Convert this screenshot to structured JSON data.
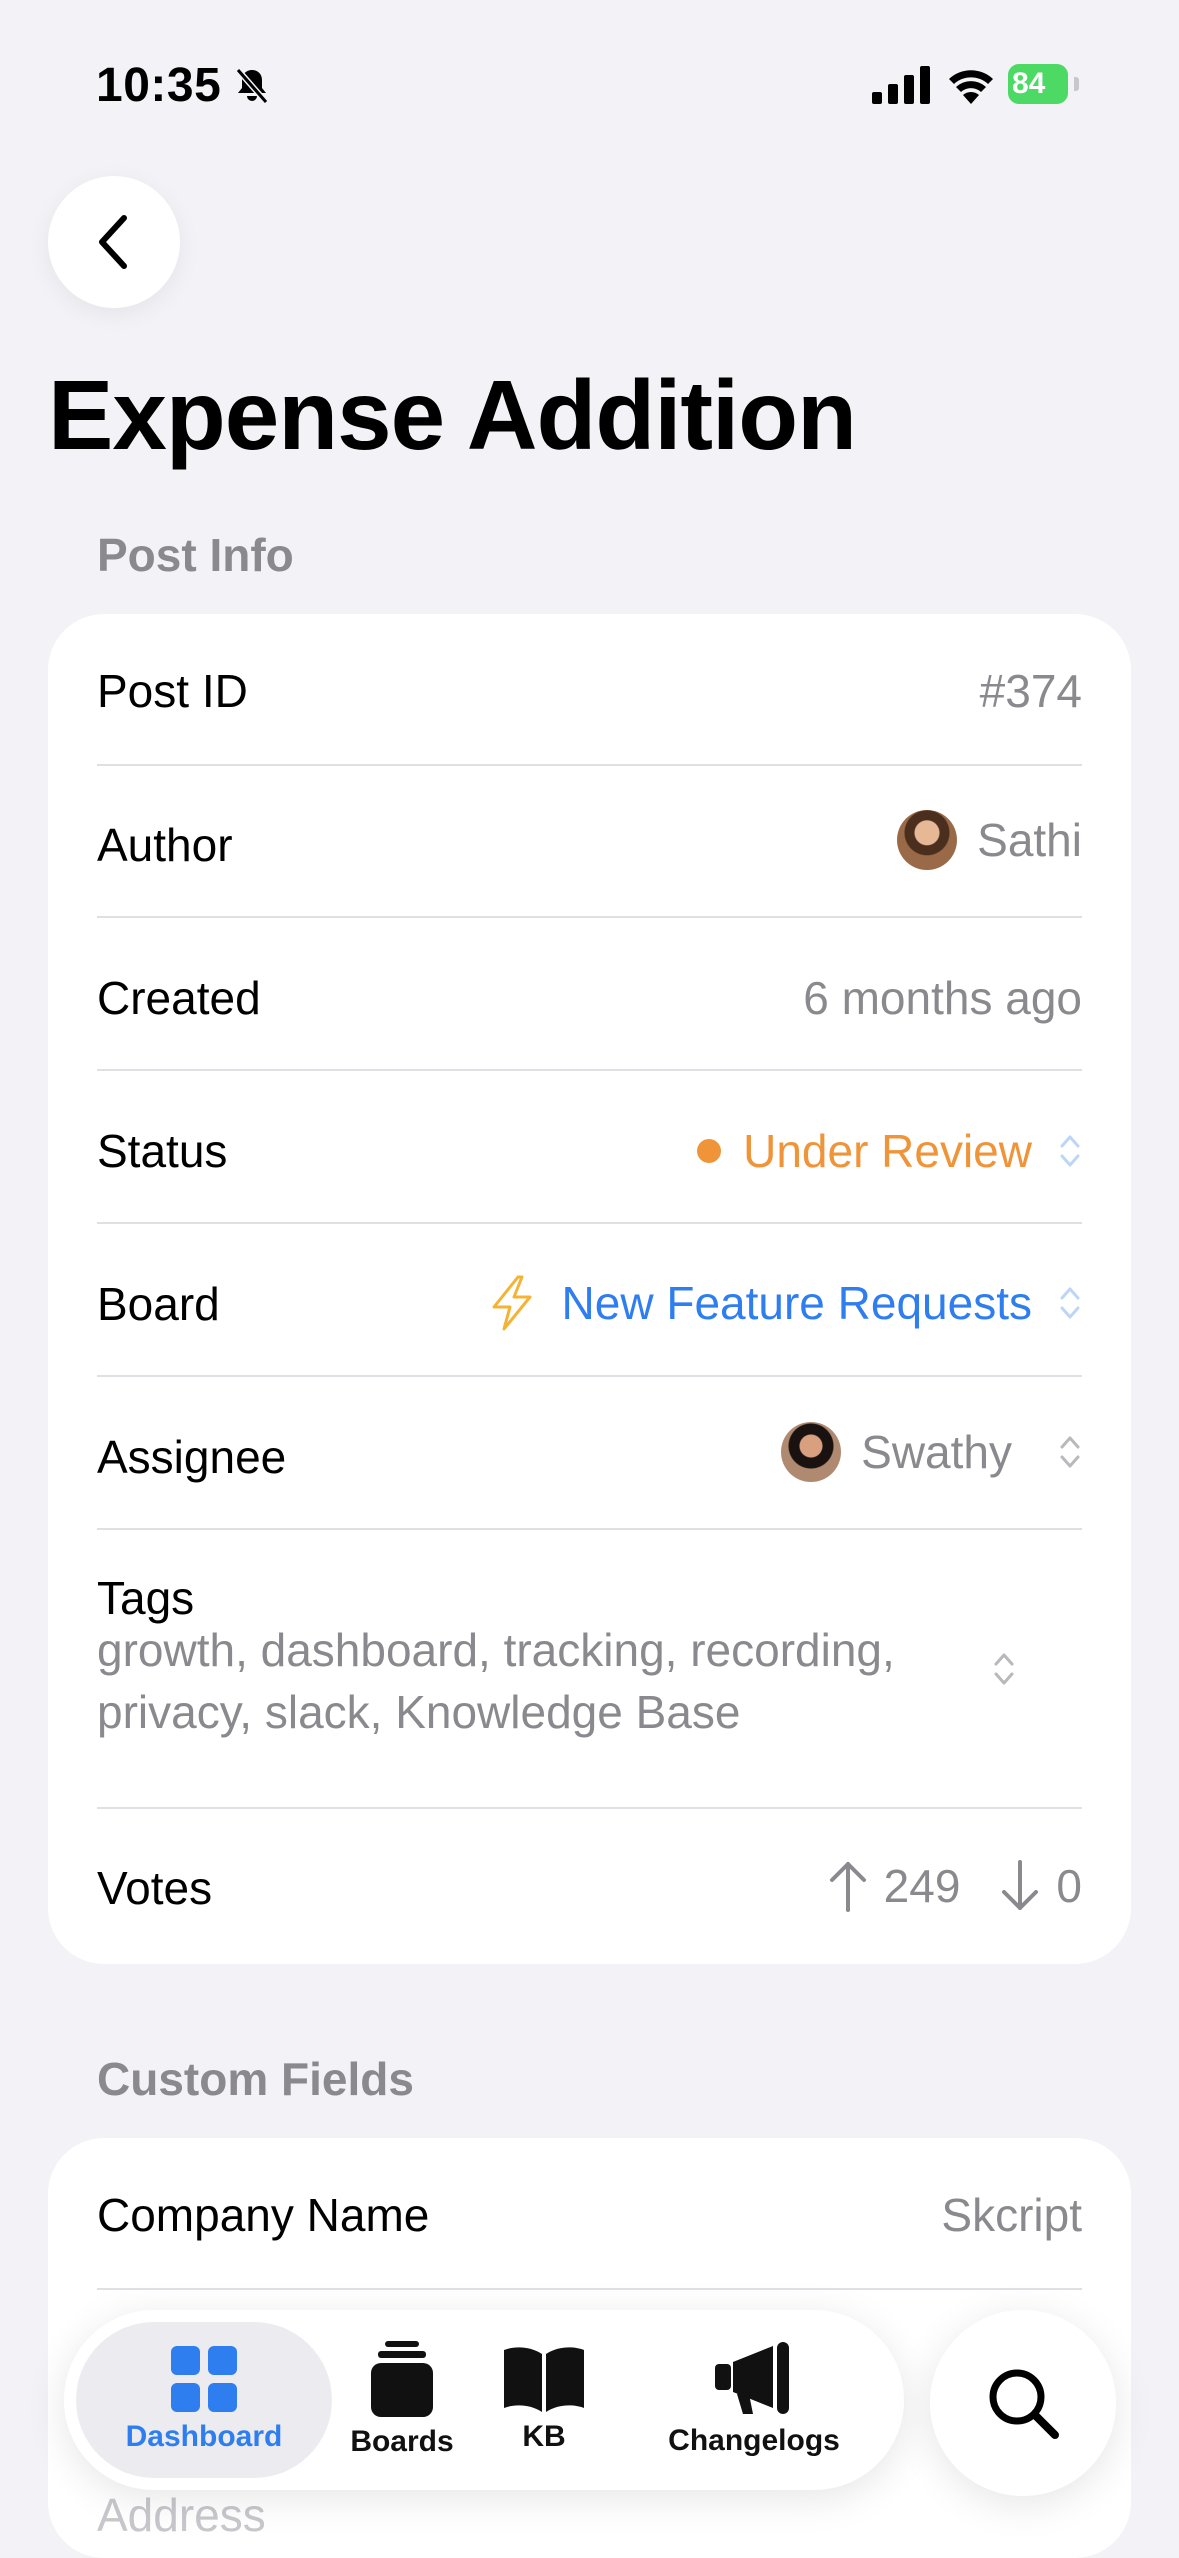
{
  "status_bar": {
    "time": "10:35",
    "battery": "84"
  },
  "page": {
    "title": "Expense Addition"
  },
  "post_info": {
    "section_label": "Post Info",
    "post_id": {
      "label": "Post ID",
      "value": "#374"
    },
    "author": {
      "label": "Author",
      "value": "Sathi"
    },
    "created": {
      "label": "Created",
      "value": "6 months ago"
    },
    "status": {
      "label": "Status",
      "value": "Under Review",
      "color": "#f0943a"
    },
    "board": {
      "label": "Board",
      "value": "New Feature Requests",
      "color": "#2f7ef0",
      "icon": "lightning-icon"
    },
    "assignee": {
      "label": "Assignee",
      "value": "Swathy"
    },
    "tags": {
      "label": "Tags",
      "value": "growth, dashboard, tracking, recording, privacy, slack, Knowledge Base"
    },
    "votes": {
      "label": "Votes",
      "up": "249",
      "down": "0"
    }
  },
  "custom_fields": {
    "section_label": "Custom Fields",
    "company_name": {
      "label": "Company Name",
      "value": "Skcript"
    },
    "address": {
      "label": "Address"
    }
  },
  "tab_bar": {
    "active": "Dashboard",
    "accent": "#2f7ef0",
    "tabs": [
      {
        "label": "Dashboard",
        "icon": "grid-icon"
      },
      {
        "label": "Boards",
        "icon": "stack-icon"
      },
      {
        "label": "KB",
        "icon": "book-icon"
      },
      {
        "label": "Changelogs",
        "icon": "megaphone-icon"
      }
    ],
    "search_icon": "search-icon"
  }
}
